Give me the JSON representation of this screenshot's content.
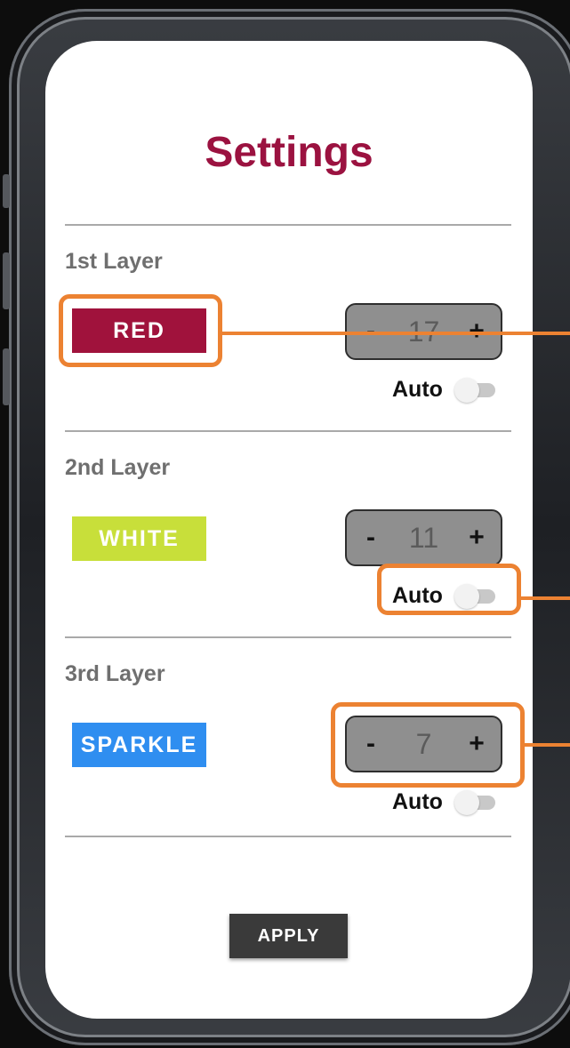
{
  "screen": {
    "title": "Settings",
    "layers": [
      {
        "label": "1st Layer",
        "color_name": "RED",
        "color": "#a0123c",
        "value": "17",
        "auto_label": "Auto",
        "auto_on": false
      },
      {
        "label": "2nd Layer",
        "color_name": "WHITE",
        "color": "#c8df3a",
        "value": "11",
        "auto_label": "Auto",
        "auto_on": false
      },
      {
        "label": "3rd Layer",
        "color_name": "SPARKLE",
        "color": "#2f8ef0",
        "value": "7",
        "auto_label": "Auto",
        "auto_on": false
      }
    ],
    "stepper_minus": "-",
    "stepper_plus": "+",
    "apply_label": "APPLY"
  },
  "annotations": {
    "color": "#ec8232"
  }
}
